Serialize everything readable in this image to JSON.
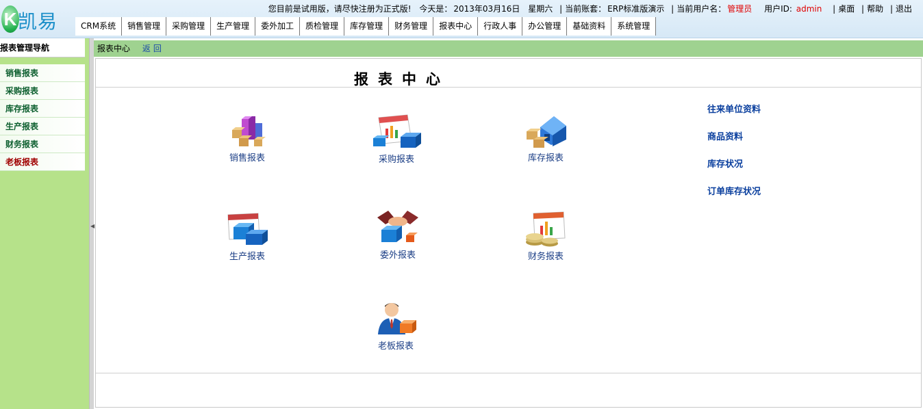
{
  "header": {
    "logo_letter": "K",
    "logo_text": "凯易通",
    "notice": "您目前是试用版，请尽快注册为正式版!",
    "today_label": "今天是：",
    "date": "2013年03月16日",
    "weekday": "星期六",
    "account_label": "当前账套：",
    "account": "ERP标准版演示",
    "user_label": "当前用户名：",
    "user": "管理员",
    "userid_label": "用户ID: ",
    "userid": "admin",
    "desktop": "桌面",
    "help": "帮助",
    "logout": "退出",
    "nav": [
      "CRM系统",
      "销售管理",
      "采购管理",
      "生产管理",
      "委外加工",
      "质检管理",
      "库存管理",
      "财务管理",
      "报表中心",
      "行政人事",
      "办公管理",
      "基础资料",
      "系统管理"
    ]
  },
  "sidebar": {
    "title": "报表管理导航",
    "items": [
      "销售报表",
      "采购报表",
      "库存报表",
      "生产报表",
      "财务报表",
      "老板报表"
    ]
  },
  "breadcrumb": {
    "current": "报表中心",
    "back": "返回"
  },
  "main": {
    "title": "报表中心",
    "tiles": [
      "销售报表",
      "采购报表",
      "库存报表",
      "生产报表",
      "委外报表",
      "财务报表",
      "老板报表"
    ],
    "quick_links": [
      "往来单位资料",
      "商品资料",
      "库存状况",
      "订单库存状况"
    ]
  },
  "colors": {
    "sidebar_bg": "#b6e28a",
    "breadcrumb_bg": "#9fd290",
    "active_item": "#a00000",
    "link": "#0a3f9e"
  }
}
